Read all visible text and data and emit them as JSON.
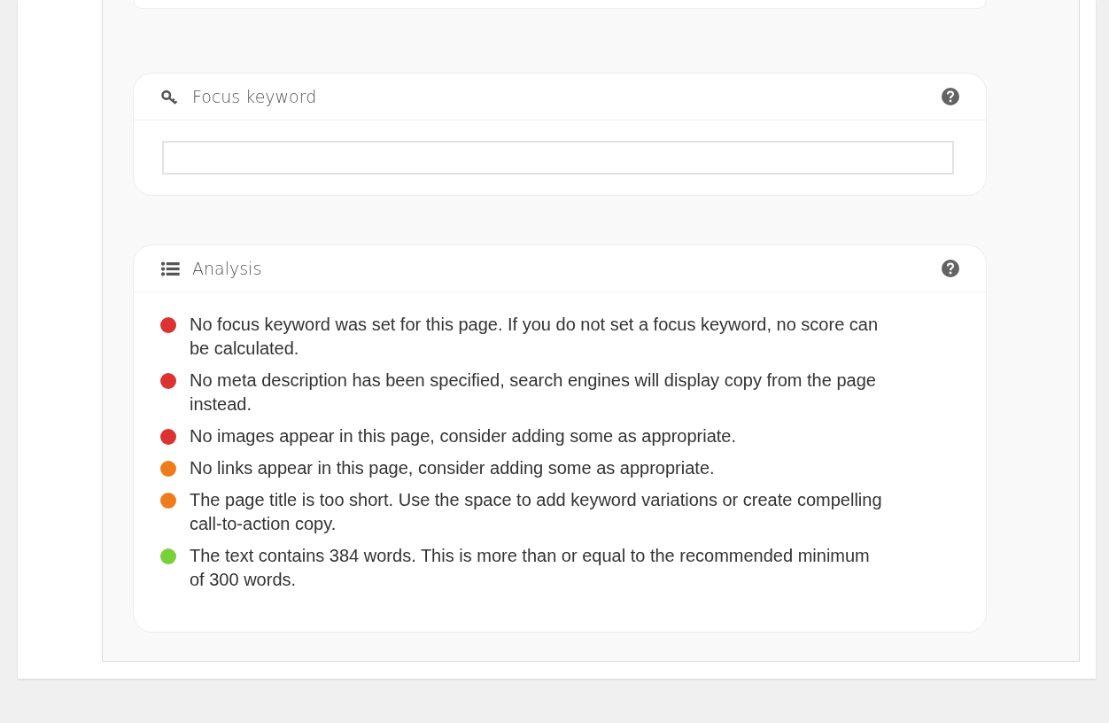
{
  "focus_keyword": {
    "title": "Focus keyword"
  },
  "analysis": {
    "title": "Analysis",
    "items": [
      {
        "text": "No focus keyword was set for this page. If you do not set a focus keyword, no score can be calculated.",
        "color": "#dc3232"
      },
      {
        "text": "No meta description has been specified, search engines will display copy from the page instead.",
        "color": "#dc3232"
      },
      {
        "text": "No images appear in this page, consider adding some as appropriate.",
        "color": "#dc3232"
      },
      {
        "text": "No links appear in this page, consider adding some as appropriate.",
        "color": "#ee7c1b"
      },
      {
        "text": "The page title is too short. Use the space to add keyword variations or create compelling call-to-action copy.",
        "color": "#ee7c1b"
      },
      {
        "text": "The text contains 384 words. This is more than or equal to the recommended minimum of 300 words.",
        "color": "#7ad03a"
      }
    ]
  }
}
